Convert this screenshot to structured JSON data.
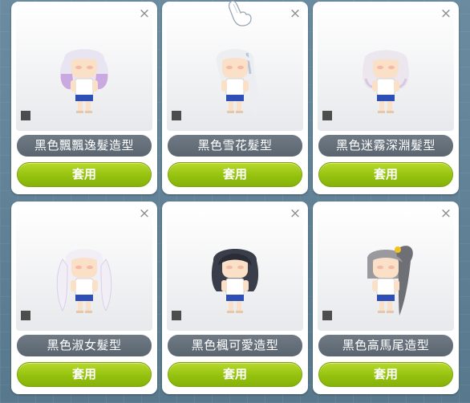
{
  "cards": [
    {
      "name": "黑色飄飄逸髮造型",
      "apply_label": "套用",
      "close_icon": "×",
      "hair_color": "#e9e4f2",
      "hair_tint": "#c9a9e0",
      "style": "curly"
    },
    {
      "name": "黑色雪花髮型",
      "apply_label": "套用",
      "close_icon": "×",
      "hair_color": "#eceef2",
      "hair_tint": "#b9c6dc",
      "style": "long-side"
    },
    {
      "name": "黑色迷霧深淵髮型",
      "apply_label": "套用",
      "close_icon": "×",
      "hair_color": "#ece6ee",
      "hair_tint": "#d7c7e2",
      "style": "bob"
    },
    {
      "name": "黑色淑女髮型",
      "apply_label": "套用",
      "close_icon": "×",
      "hair_color": "#f2eef6",
      "hair_tint": "#d9cfea",
      "style": "twintail"
    },
    {
      "name": "黑色楓可愛造型",
      "apply_label": "套用",
      "close_icon": "×",
      "hair_color": "#3a3d4a",
      "hair_tint": "#2a2c36",
      "style": "short-dark"
    },
    {
      "name": "黑色高馬尾造型",
      "apply_label": "套用",
      "close_icon": "×",
      "hair_color": "#9a9a9e",
      "hair_tint": "#6f7075",
      "style": "ponytail"
    }
  ],
  "colors": {
    "apply_button": "#9bc816",
    "name_pill": "#646f7a",
    "skin": "#fbe0c8",
    "shirt": "#ffffff",
    "shorts": "#2e4fb5"
  },
  "icons": {
    "close": "close-icon",
    "marker": "square-marker-icon",
    "cursor": "hand-cursor-icon"
  }
}
